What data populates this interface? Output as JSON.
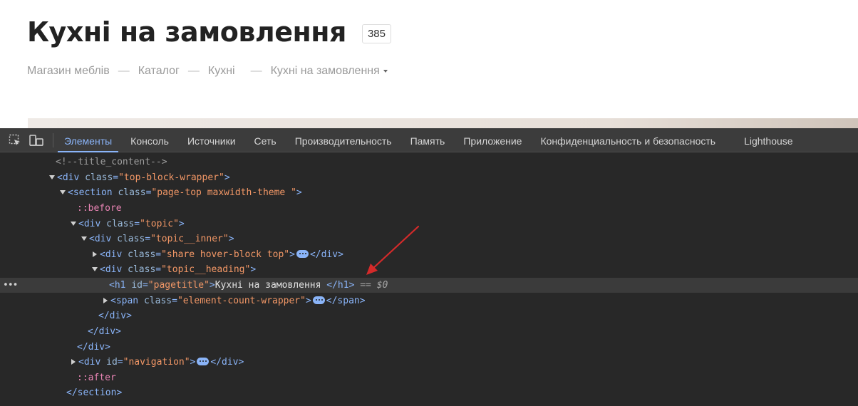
{
  "page": {
    "title": "Кухні на замовлення",
    "count_badge": "385",
    "breadcrumb": [
      {
        "label": "Магазин меблів"
      },
      {
        "label": "Каталог"
      },
      {
        "label": "Кухні"
      },
      {
        "label": "Кухні на замовлення"
      }
    ],
    "breadcrumb_separator": "—"
  },
  "devtools": {
    "icons": [
      "element-picker-icon",
      "device-toolbar-icon"
    ],
    "tabs": [
      {
        "label": "Элементы",
        "active": true
      },
      {
        "label": "Консоль"
      },
      {
        "label": "Источники"
      },
      {
        "label": "Сеть"
      },
      {
        "label": "Производительность"
      },
      {
        "label": "Память"
      },
      {
        "label": "Приложение"
      },
      {
        "label": "Конфиденциальность и безопасность"
      },
      {
        "label": "Lighthouse"
      }
    ],
    "dom": {
      "l0": {
        "comment": "<!--title_content-->"
      },
      "l1": {
        "open": "<div",
        "a1": "class",
        "v1": "\"top-block-wrapper\"",
        "close": ">"
      },
      "l2": {
        "open": "<section",
        "a1": "class",
        "v1": "\"page-top maxwidth-theme \"",
        "close": ">"
      },
      "l3": {
        "pseudo": "::before"
      },
      "l4": {
        "open": "<div",
        "a1": "class",
        "v1": "\"topic\"",
        "close": ">"
      },
      "l5": {
        "open": "<div",
        "a1": "class",
        "v1": "\"topic__inner\"",
        "close": ">"
      },
      "l6": {
        "open": "<div",
        "a1": "class",
        "v1": "\"share hover-block top\"",
        "close": ">",
        "end": "</div>"
      },
      "l7": {
        "open": "<div",
        "a1": "class",
        "v1": "\"topic__heading\"",
        "close": ">"
      },
      "l8": {
        "open": "<h1",
        "a1": "id",
        "v1": "\"pagetitle\"",
        "close": ">",
        "text": "Кухні на замовлення ",
        "end": "</h1>",
        "eq": " == ",
        "dollar": "$0"
      },
      "l9": {
        "open": "<span",
        "a1": "class",
        "v1": "\"element-count-wrapper\"",
        "close": ">",
        "end": "</span>"
      },
      "l10": {
        "end": "</div>"
      },
      "l11": {
        "end": "</div>"
      },
      "l12": {
        "end": "</div>"
      },
      "l13": {
        "open": "<div",
        "a1": "id",
        "v1": "\"navigation\"",
        "close": ">",
        "end": "</div>"
      },
      "l14": {
        "pseudo": "::after"
      },
      "l15": {
        "end": "</section>"
      }
    }
  },
  "colors": {
    "annotation_arrow": "#d42a2a",
    "devtools_bg": "#282828",
    "tag": "#8ab4f8",
    "attr_value": "#f29766"
  }
}
